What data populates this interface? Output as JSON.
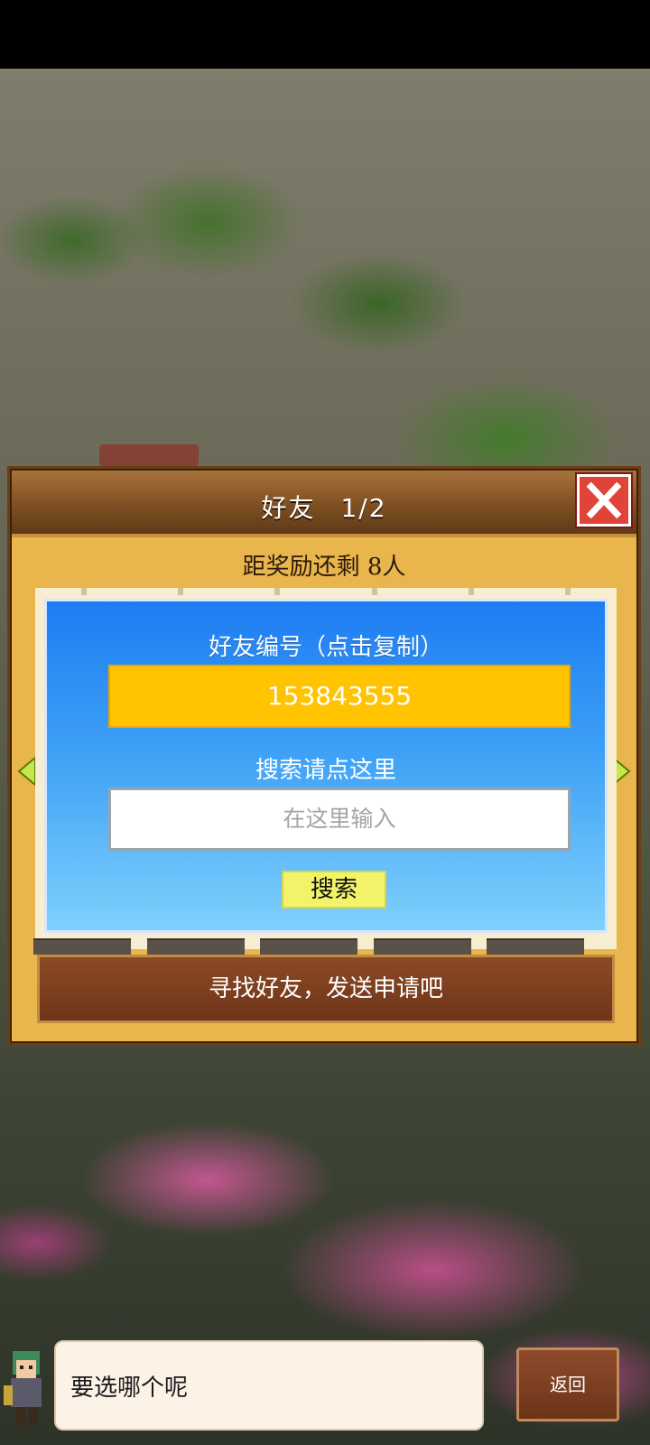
{
  "dialog": {
    "title": "好友",
    "page": "1/2",
    "reward_text": "距奖励还剩 8人",
    "friend_id_label": "好友编号（点击复制）",
    "friend_id_value": "153843555",
    "search_hint": "搜索请点这里",
    "search_placeholder": "在这里输入",
    "search_button": "搜索",
    "banner_text": "寻找好友，发送申请吧"
  },
  "bottom": {
    "speech_text": "要选哪个呢",
    "back_button": "返回"
  },
  "colors": {
    "panel_blue": "#1e7cf2",
    "id_yellow": "#ffc300",
    "close_red": "#e04438",
    "dialog_gold": "#e9b54d"
  },
  "icons": {
    "close": "close-icon",
    "prev": "arrow-left-icon",
    "next": "arrow-right-icon"
  }
}
